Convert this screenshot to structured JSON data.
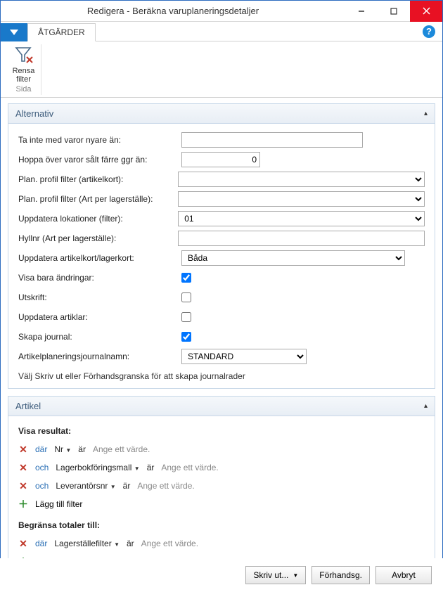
{
  "window": {
    "title": "Redigera - Beräkna varuplaneringsdetaljer"
  },
  "ribbon": {
    "actions_tab": "ÅTGÄRDER",
    "clear_filter_label": "Rensa\nfilter",
    "group_sub": "Sida"
  },
  "panels": {
    "alternativ": {
      "title": "Alternativ",
      "fields": {
        "newer_than": "Ta inte med varor nyare än:",
        "sold_fewer": "Hoppa över varor sålt färre ggr än:",
        "sold_fewer_value": "0",
        "plan_profile_artikelkort": "Plan. profil filter (artikelkort):",
        "plan_profile_art_per": "Plan. profil filter (Art per lagerställe):",
        "update_locations": "Uppdatera lokationer (filter):",
        "update_locations_value": "01",
        "hyllnr": "Hyllnr (Art per lagerställe):",
        "update_artikelkort": "Uppdatera artikelkort/lagerkort:",
        "update_artikelkort_value": "Båda",
        "visa_bara": "Visa bara ändringar:",
        "utskrift": "Utskrift:",
        "uppdatera_artiklar": "Uppdatera artiklar:",
        "skapa_journal": "Skapa journal:",
        "journal_name": "Artikelplaneringsjournalnamn:",
        "journal_name_value": "STANDARD",
        "note": "Välj Skriv ut eller Förhandsgranska för att skapa journalrader"
      }
    },
    "artikel": {
      "title": "Artikel",
      "visa_resultat": "Visa resultat:",
      "begransa": "Begränsa totaler till:",
      "kw_where": "där",
      "kw_and": "och",
      "kw_is": "är",
      "placeholder": "Ange ett värde.",
      "add_filter": "Lägg till filter",
      "rows": [
        {
          "kw": "där",
          "field": "Nr"
        },
        {
          "kw": "och",
          "field": "Lagerbokföringsmall"
        },
        {
          "kw": "och",
          "field": "Leverantörsnr"
        }
      ],
      "limit_rows": [
        {
          "kw": "där",
          "field": "Lagerställefilter"
        }
      ]
    }
  },
  "footer": {
    "print": "Skriv ut...",
    "preview": "Förhandsg.",
    "cancel": "Avbryt"
  }
}
